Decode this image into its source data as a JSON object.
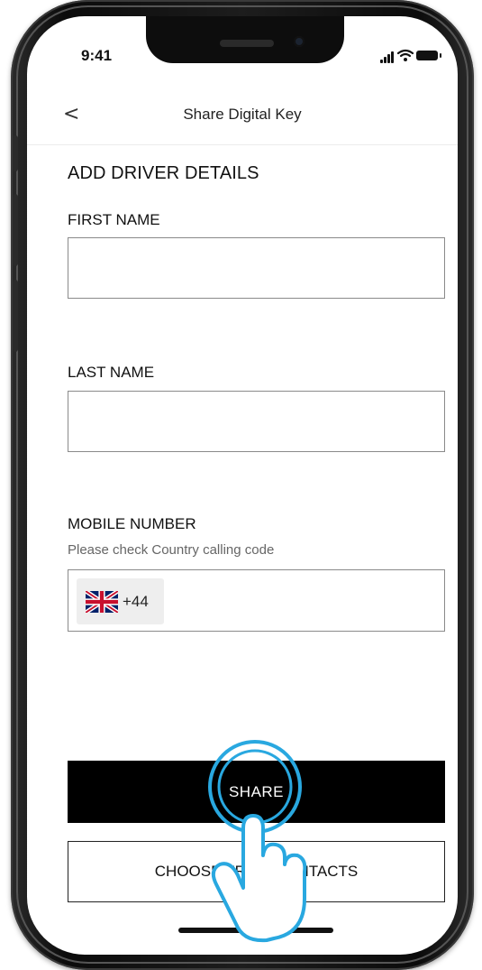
{
  "status_bar": {
    "time": "9:41"
  },
  "header": {
    "back_glyph": "<",
    "title": "Share Digital Key"
  },
  "form": {
    "heading": "ADD DRIVER DETAILS",
    "first_name": {
      "label": "FIRST NAME",
      "value": ""
    },
    "last_name": {
      "label": "LAST NAME",
      "value": ""
    },
    "mobile": {
      "label": "MOBILE NUMBER",
      "helper": "Please check Country calling code",
      "country_icon": "uk-flag-icon",
      "calling_code": "+44",
      "value": ""
    }
  },
  "actions": {
    "share_label": "SHARE",
    "choose_contacts_label": "CHOOSE FROM CONTACTS"
  },
  "overlay": {
    "gesture_icon": "tap-hand-icon"
  },
  "colors": {
    "primary_button": "#000000",
    "border": "#8a8a8a",
    "gesture_highlight": "#29a8e0"
  }
}
